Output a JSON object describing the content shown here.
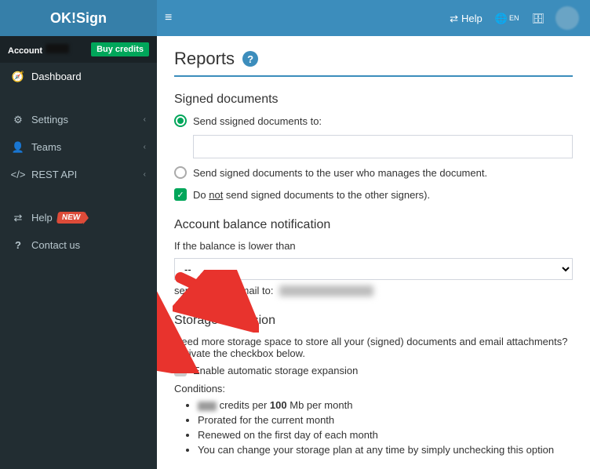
{
  "brand": "OK!Sign",
  "account": {
    "label": "Account",
    "buy_credits": "Buy credits"
  },
  "sidebar": {
    "items": [
      {
        "icon": "🧭",
        "label": "Dashboard"
      },
      {
        "icon": "⚙",
        "label": "Settings",
        "caret": "‹"
      },
      {
        "icon": "👤",
        "label": "Teams",
        "caret": "‹"
      },
      {
        "icon": "</>",
        "label": "REST API",
        "caret": "‹"
      },
      {
        "icon": "⇄",
        "label": "Help",
        "badge": "NEW"
      },
      {
        "icon": "?",
        "label": "Contact us"
      }
    ]
  },
  "topbar": {
    "help": "Help",
    "lang": "EN"
  },
  "page": {
    "title": "Reports"
  },
  "signed_docs": {
    "heading": "Signed documents",
    "opt1": "Send ssigned documents to:",
    "input_value": "",
    "opt2": "Send signed documents to the user who manages the document.",
    "check_prefix": "Do ",
    "check_not": "not",
    "check_suffix": " send signed documents to the other signers)."
  },
  "balance": {
    "heading": "Account balance notification",
    "label": "If the balance is lower than",
    "select_value": "--",
    "email_prefix": "send a daily e-mail to:"
  },
  "storage": {
    "heading": "Storage extension",
    "desc": "Need more storage space to store all your (signed) documents and email attachments? Activate the checkbox below.",
    "checkbox_label": "Enable automatic storage expansion",
    "conditions_label": "Conditions:",
    "cond1_mid": " credits per ",
    "cond1_bold": "100",
    "cond1_tail": " Mb per month",
    "cond2": "Prorated for the current month",
    "cond3": "Renewed on the first day of each month",
    "cond4": "You can change your storage plan at any time by simply unchecking this option"
  }
}
